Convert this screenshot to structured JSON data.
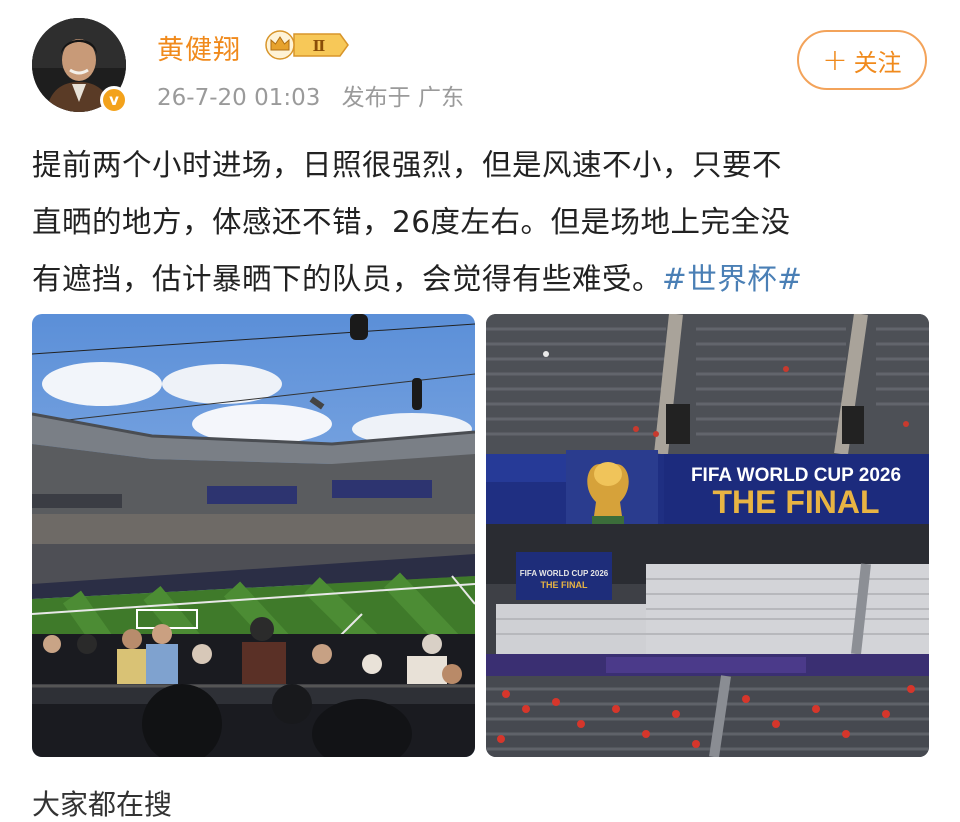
{
  "author": {
    "name": "黄健翔",
    "level_badge": "Ⅱ",
    "verified_mark": "v"
  },
  "meta": {
    "timestamp": "26-7-20 01:03",
    "location": "发布于 广东"
  },
  "follow_button": {
    "plus": "+",
    "label": "关注"
  },
  "post": {
    "line1": "提前两个小时进场，日照很强烈，但是风速不小，只要不",
    "line2": "直晒的地方，体感还不错，26度左右。但是场地上完全没",
    "line3_text": "有遮挡，估计暴晒下的队员，会觉得有些难受。",
    "topic": "#世界杯#"
  },
  "photos": {
    "right": {
      "banner_line1": "FIFA WORLD CUP 2026",
      "banner_line2": "THE FINAL",
      "small_board": "FIFA WORLD CUP 2026",
      "small_board_sub": "THE FINAL"
    }
  },
  "footer_text": "大家都在搜",
  "colors": {
    "accent": "#f08a1c",
    "topic": "#4a7fb5",
    "banner_navy": "#1f2f82",
    "banner_gold": "#e8b443"
  }
}
